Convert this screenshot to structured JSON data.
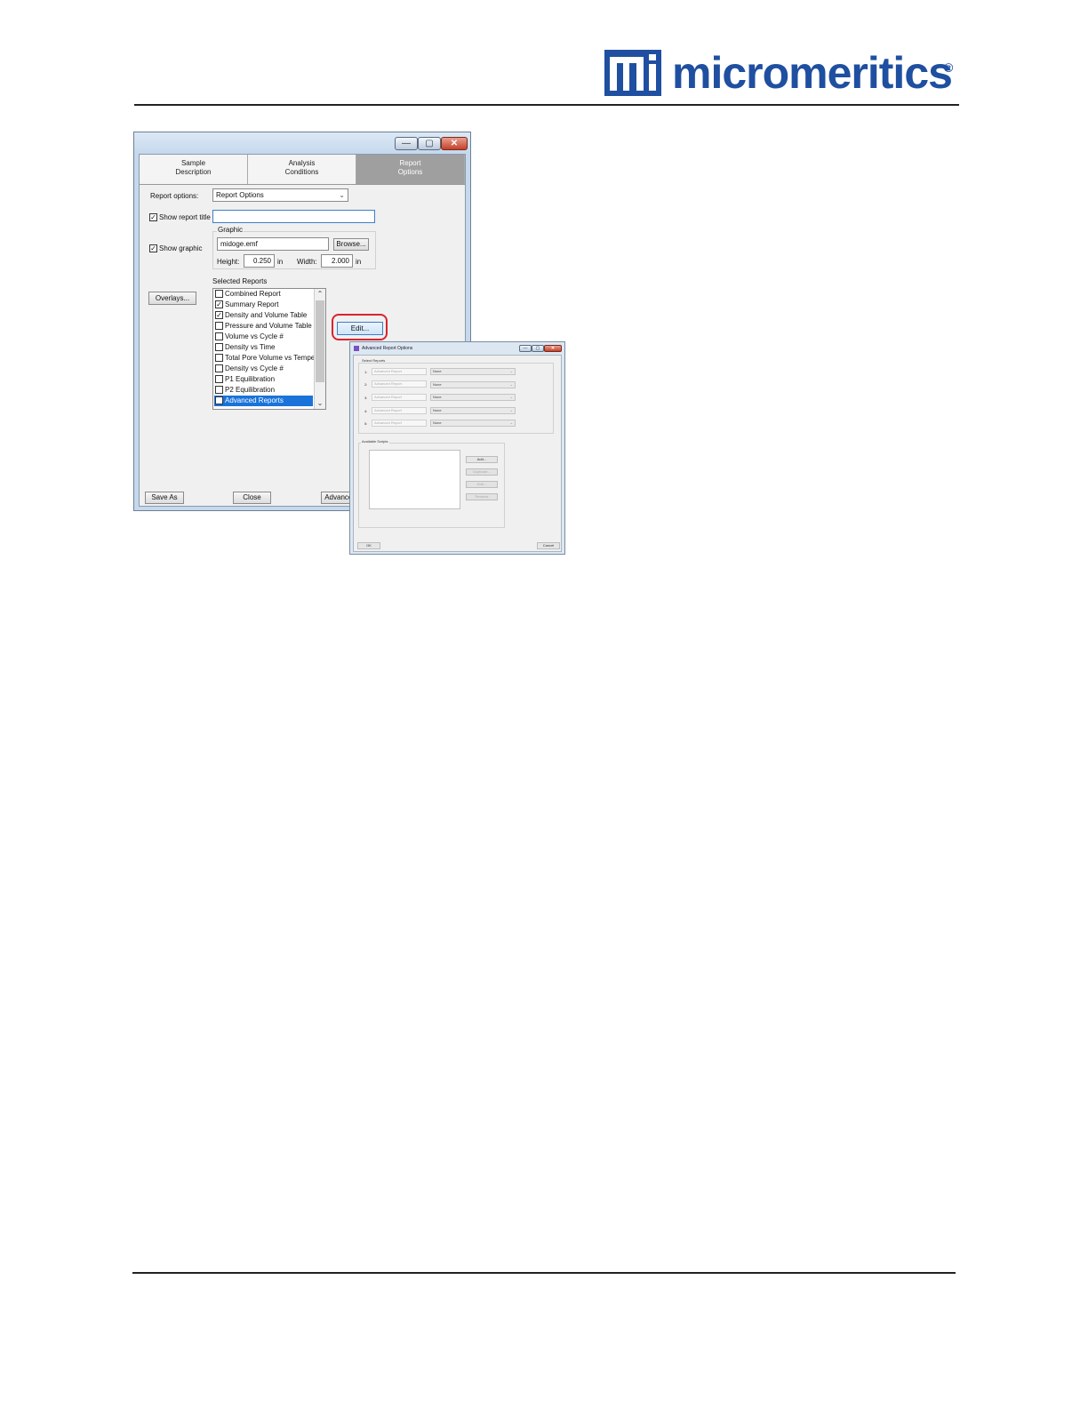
{
  "logo": {
    "text": "micromeritics",
    "reg": "®",
    "brand_color": "#1f4fa0"
  },
  "window": {
    "tabs": [
      {
        "label": "Sample\nDescription",
        "active": false
      },
      {
        "label": "Analysis\nConditions",
        "active": false
      },
      {
        "label": "Report\nOptions",
        "active": true
      }
    ],
    "report_options_label": "Report options:",
    "report_options_value": "Report Options",
    "show_report_title_label": "Show report title",
    "report_title_value": "",
    "show_graphic_label": "Show graphic",
    "graphic_group_label": "Graphic",
    "graphic_file": "midoge.emf",
    "browse_label": "Browse...",
    "height_label": "Height:",
    "height_value": "0.250",
    "height_unit": "in",
    "width_label": "Width:",
    "width_value": "2.000",
    "width_unit": "in",
    "overlays_label": "Overlays...",
    "selected_reports_label": "Selected Reports",
    "reports": [
      {
        "label": "Combined Report",
        "checked": false,
        "selected": false
      },
      {
        "label": "Summary Report",
        "checked": true,
        "selected": false
      },
      {
        "label": "Density and Volume Table",
        "checked": true,
        "selected": false
      },
      {
        "label": "Pressure and Volume Table",
        "checked": false,
        "selected": false
      },
      {
        "label": "Volume vs Cycle #",
        "checked": false,
        "selected": false
      },
      {
        "label": "Density vs Time",
        "checked": false,
        "selected": false
      },
      {
        "label": "Total Pore Volume vs Temperature",
        "checked": false,
        "selected": false
      },
      {
        "label": "Density vs Cycle #",
        "checked": false,
        "selected": false
      },
      {
        "label": "P1 Equilibration",
        "checked": false,
        "selected": false
      },
      {
        "label": "P2 Equilibration",
        "checked": false,
        "selected": false
      },
      {
        "label": "Advanced Reports",
        "checked": false,
        "selected": true
      }
    ],
    "edit_label": "Edit...",
    "save_as_label": "Save As",
    "close_label": "Close",
    "advanced_label": "Advanced",
    "highlight_color": "#d9232e"
  },
  "advanced_dialog": {
    "title": "Advanced Report Options",
    "select_reports_label": "Select Reports",
    "rows": [
      {
        "num": "1:",
        "field": "Advanced Report",
        "value": "None"
      },
      {
        "num": "2:",
        "field": "Advanced Report",
        "value": "None"
      },
      {
        "num": "3:",
        "field": "Advanced Report",
        "value": "None"
      },
      {
        "num": "4:",
        "field": "Advanced Report",
        "value": "None"
      },
      {
        "num": "5:",
        "field": "Advanced Report",
        "value": "None"
      }
    ],
    "available_scripts_label": "Available Scripts",
    "add_label": "Add...",
    "duplicate_label": "Duplicate...",
    "edit_label": "Edit...",
    "remove_label": "Remove",
    "ok_label": "OK",
    "cancel_label": "Cancel"
  }
}
